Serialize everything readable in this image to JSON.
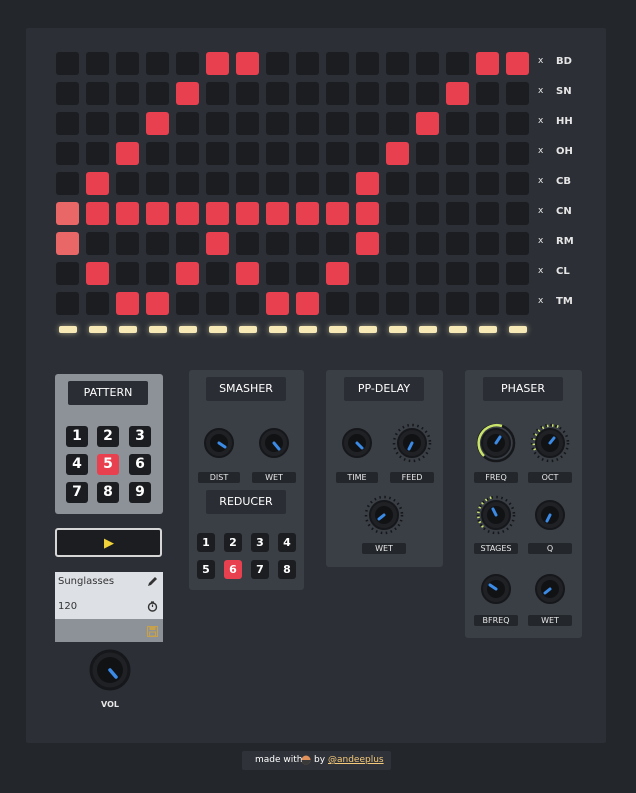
{
  "tracks": [
    {
      "label": "BD",
      "clear": "x",
      "steps": [
        0,
        0,
        0,
        0,
        0,
        1,
        1,
        0,
        0,
        0,
        0,
        0,
        0,
        0,
        1,
        1
      ]
    },
    {
      "label": "SN",
      "clear": "x",
      "steps": [
        0,
        0,
        0,
        0,
        1,
        0,
        0,
        0,
        0,
        0,
        0,
        0,
        0,
        1,
        0,
        0
      ]
    },
    {
      "label": "HH",
      "clear": "x",
      "steps": [
        0,
        0,
        0,
        1,
        0,
        0,
        0,
        0,
        0,
        0,
        0,
        0,
        1,
        0,
        0,
        0
      ]
    },
    {
      "label": "OH",
      "clear": "x",
      "steps": [
        0,
        0,
        1,
        0,
        0,
        0,
        0,
        0,
        0,
        0,
        0,
        1,
        0,
        0,
        0,
        0
      ]
    },
    {
      "label": "CB",
      "clear": "x",
      "steps": [
        0,
        1,
        0,
        0,
        0,
        0,
        0,
        0,
        0,
        0,
        1,
        0,
        0,
        0,
        0,
        0
      ]
    },
    {
      "label": "CN",
      "clear": "x",
      "steps": [
        2,
        1,
        1,
        1,
        1,
        1,
        1,
        1,
        1,
        1,
        1,
        0,
        0,
        0,
        0,
        0
      ]
    },
    {
      "label": "RM",
      "clear": "x",
      "steps": [
        2,
        0,
        0,
        0,
        0,
        1,
        0,
        0,
        0,
        0,
        1,
        0,
        0,
        0,
        0,
        0
      ]
    },
    {
      "label": "CL",
      "clear": "x",
      "steps": [
        0,
        1,
        0,
        0,
        1,
        0,
        1,
        0,
        0,
        1,
        0,
        0,
        0,
        0,
        0,
        0
      ]
    },
    {
      "label": "TM",
      "clear": "x",
      "steps": [
        0,
        0,
        1,
        1,
        0,
        0,
        0,
        1,
        1,
        0,
        0,
        0,
        0,
        0,
        0,
        0
      ]
    }
  ],
  "pattern": {
    "title": "PATTERN",
    "numbers": [
      "1",
      "2",
      "3",
      "4",
      "5",
      "6",
      "7",
      "8",
      "9"
    ],
    "selected": "5"
  },
  "play": {
    "icon": "play-icon",
    "glyph": "▶"
  },
  "song": {
    "name": "Sunglasses",
    "bpm": "120",
    "name_icon": "pencil-icon",
    "bpm_icon": "tempo-icon",
    "save_icon": "save-icon"
  },
  "volume": {
    "label": "VOL"
  },
  "smasher": {
    "title": "SMASHER",
    "knobs": [
      "DIST",
      "WET"
    ]
  },
  "reducer": {
    "title": "REDUCER",
    "numbers": [
      "1",
      "2",
      "3",
      "4",
      "5",
      "6",
      "7",
      "8"
    ],
    "selected": "6"
  },
  "ppdelay": {
    "title": "PP-DELAY",
    "knobs": [
      "TIME",
      "FEED",
      "WET"
    ]
  },
  "phaser": {
    "title": "PHASER",
    "knobs": [
      "FREQ",
      "OCT",
      "STAGES",
      "Q",
      "BFREQ",
      "WET"
    ]
  },
  "footer": {
    "prefix": "made with",
    "by": "by",
    "handle": "@andeeplus",
    "icon": "cookie-icon"
  },
  "colors": {
    "active_step": "#e8404f",
    "current_step": "#ea6768",
    "led": "#f6e9b6",
    "knob_indicator": "#3b8be6",
    "accent_ring": "#c9e36b"
  }
}
